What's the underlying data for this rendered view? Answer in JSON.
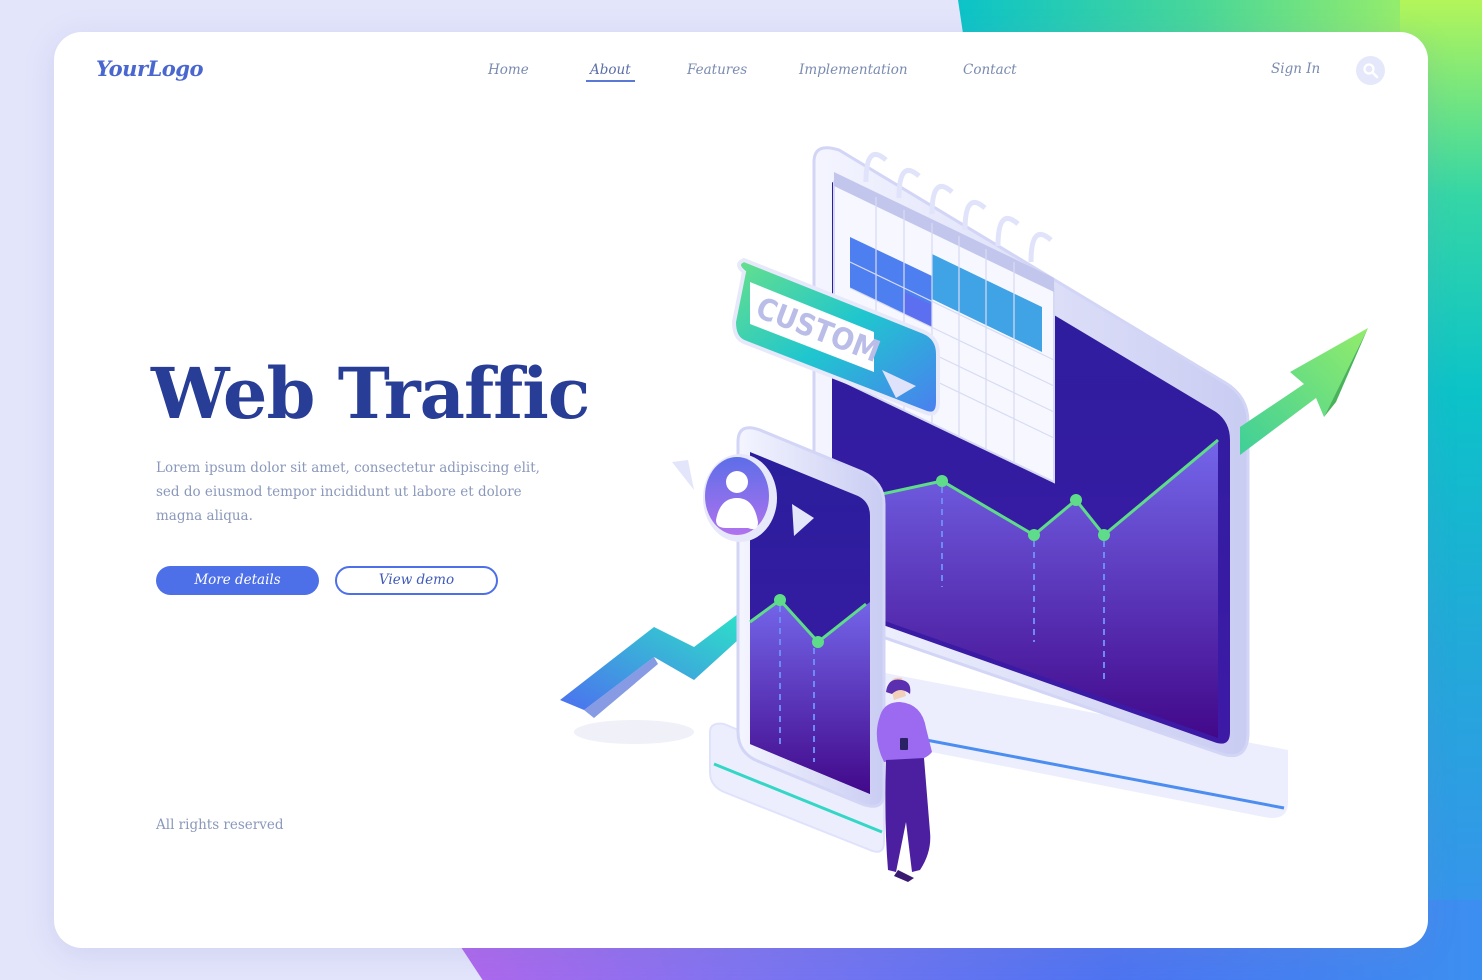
{
  "header": {
    "logo": "YourLogo",
    "nav": [
      {
        "label": "Home",
        "active": false
      },
      {
        "label": "About",
        "active": true
      },
      {
        "label": "Features",
        "active": false
      },
      {
        "label": "Implementation",
        "active": false
      },
      {
        "label": "Contact",
        "active": false
      }
    ],
    "sign_in": "Sign In",
    "search_icon": "search-icon"
  },
  "hero": {
    "title": "Web Traffic",
    "body": "Lorem ipsum dolor sit amet, consectetur adipiscing elit, sed do eiusmod tempor incididunt ut labore et dolore magna aliqua.",
    "primary_button": "More details",
    "secondary_button": "View demo"
  },
  "illustration": {
    "custom_badge": "CUSTOM",
    "icons": [
      "calendar-icon",
      "user-avatar-icon",
      "up-arrow-icon",
      "play-icon"
    ]
  },
  "footer": {
    "copyright": "All rights reserved"
  },
  "colors": {
    "accent": "#4d6fe8",
    "title": "#273d96",
    "text": "#8a98bb",
    "screen": "#3a1fa8",
    "chart_line": "#5fdc8a"
  }
}
